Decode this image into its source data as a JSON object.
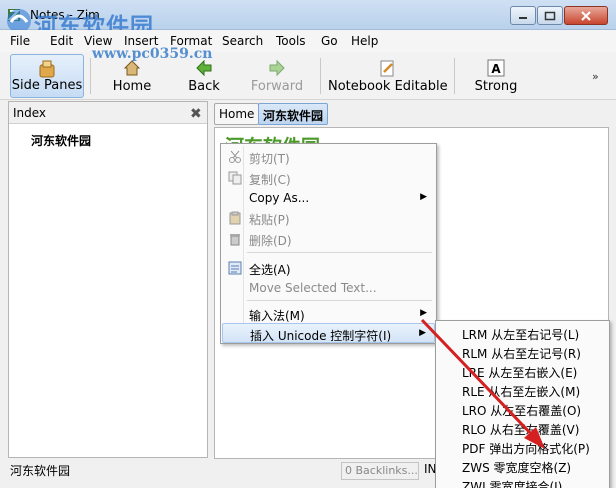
{
  "window": {
    "title": "Notes - Zim",
    "watermark_text": "河东软件园",
    "watermark_url": "www.pc0359.cn"
  },
  "menu": [
    {
      "label": "File",
      "key": "F"
    },
    {
      "label": "Edit",
      "key": "E"
    },
    {
      "label": "View",
      "key": "V"
    },
    {
      "label": "Insert",
      "key": "I"
    },
    {
      "label": "Format",
      "key": "o"
    },
    {
      "label": "Search",
      "key": "S"
    },
    {
      "label": "Tools",
      "key": "T"
    },
    {
      "label": "Go",
      "key": "G"
    },
    {
      "label": "Help",
      "key": "H"
    }
  ],
  "toolbar": {
    "side_panes": "Side Panes",
    "home": "Home",
    "back": "Back",
    "forward": "Forward",
    "notebook_editable": "Notebook Editable",
    "strong": "Strong",
    "more": "»"
  },
  "side_pane": {
    "title": "Index",
    "items": [
      "河东软件园"
    ]
  },
  "pathbar": {
    "crumbs": [
      "Home",
      "河东软件园"
    ]
  },
  "editor": {
    "heading": "河东软件园"
  },
  "status": {
    "page": "河东软件园",
    "backlinks": "0 Backlinks...",
    "mode": "IN"
  },
  "context_menu": {
    "items": [
      {
        "label": "剪切(T)",
        "icon": "scissors-icon",
        "disabled": true
      },
      {
        "label": "复制(C)",
        "icon": "copy-icon",
        "disabled": true
      },
      {
        "label": "Copy As...",
        "submenu": true,
        "disabled": false
      },
      {
        "label": "粘贴(P)",
        "icon": "paste-icon",
        "disabled": true
      },
      {
        "label": "删除(D)",
        "icon": "delete-icon",
        "disabled": true
      },
      {
        "label": "全选(A)",
        "icon": "select-all-icon",
        "disabled": false
      },
      {
        "label": "Move Selected Text...",
        "disabled": true
      },
      {
        "label": "输入法(M)",
        "submenu": true,
        "disabled": false
      },
      {
        "label": "插入 Unicode 控制字符(I)",
        "submenu": true,
        "disabled": false,
        "highlighted": true
      }
    ]
  },
  "unicode_submenu": {
    "items": [
      "LRM 从左至右记号(L)",
      "RLM 从右至左记号(R)",
      "LRE 从左至右嵌入(E)",
      "RLE 从右至左嵌入(M)",
      "LRO 从左至右覆盖(O)",
      "RLO 从右至左覆盖(V)",
      "PDF 弹出方向格式化(P)",
      "ZWS 零宽度空格(Z)",
      "ZWJ 零宽度接合(J)"
    ]
  },
  "colors": {
    "heading_green": "#4c9a2a",
    "arrow_red": "#d42020",
    "highlight_blue": "#d3e4f7"
  }
}
